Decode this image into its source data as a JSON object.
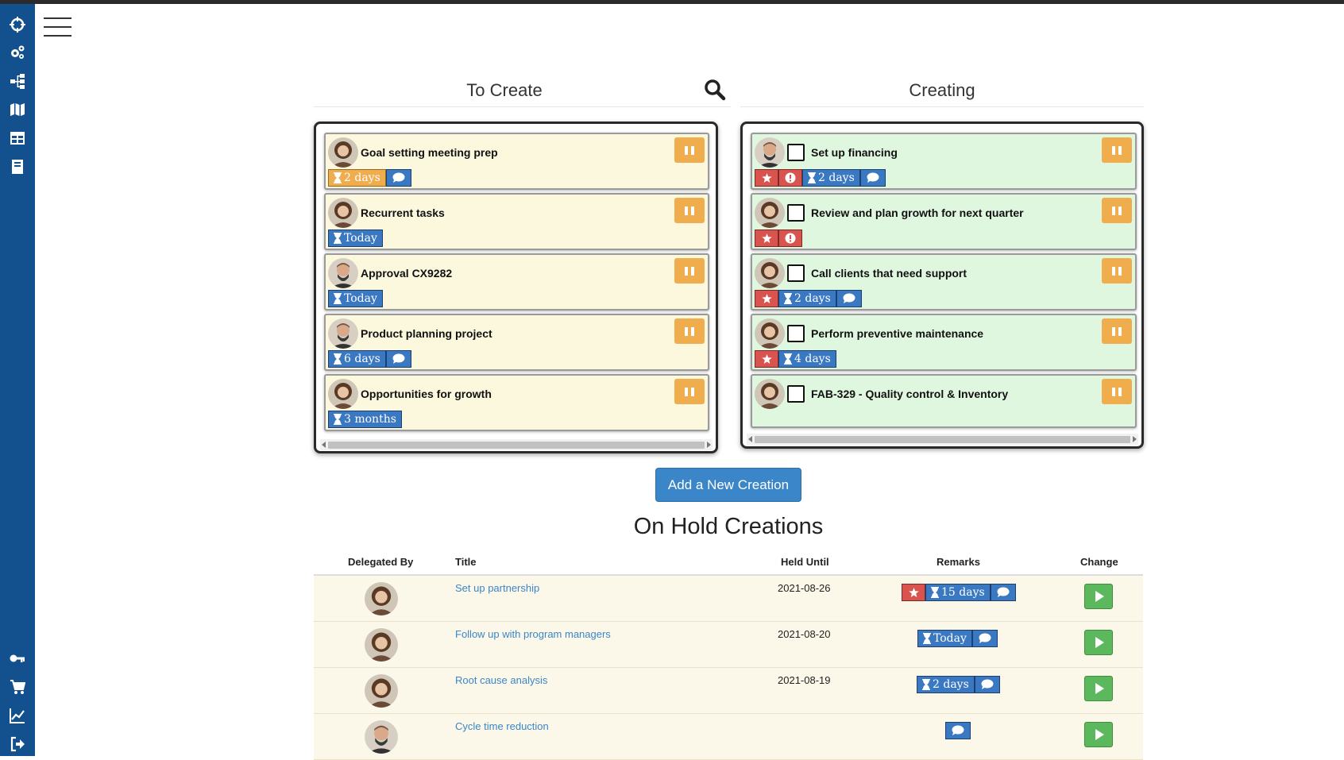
{
  "headers": {
    "to_create": "To Create",
    "creating": "Creating"
  },
  "to_create_cards": [
    {
      "title": "Goal setting meeting prep",
      "time": "2 days",
      "time_style": "orange",
      "chat": true
    },
    {
      "title": "Recurrent tasks",
      "time": "Today",
      "time_style": "blue",
      "chat": false
    },
    {
      "title": "Approval CX9282",
      "time": "Today",
      "time_style": "blue",
      "chat": false
    },
    {
      "title": "Product planning project",
      "time": "6 days",
      "time_style": "blue",
      "chat": true
    },
    {
      "title": "Opportunities for growth",
      "time": "3 months",
      "time_style": "blue",
      "chat": false
    }
  ],
  "creating_cards": [
    {
      "title": "Set up financing",
      "star": true,
      "alert": true,
      "time": "2 days",
      "chat": true
    },
    {
      "title": "Review and plan growth for next quarter",
      "star": true,
      "alert": true,
      "time": "",
      "chat": false
    },
    {
      "title": "Call clients that need support",
      "star": true,
      "alert": false,
      "time": "2 days",
      "chat": true
    },
    {
      "title": "Perform preventive maintenance",
      "star": true,
      "alert": false,
      "time": "4 days",
      "chat": false
    },
    {
      "title": "FAB-329 - Quality control & Inventory",
      "star": false,
      "alert": false,
      "time": "",
      "chat": false
    }
  ],
  "add_button_label": "Add a New Creation",
  "on_hold_title": "On Hold Creations",
  "table_headers": {
    "delegated_by": "Delegated By",
    "title": "Title",
    "held_until": "Held Until",
    "remarks": "Remarks",
    "change": "Change"
  },
  "on_hold_rows": [
    {
      "title": "Set up partnership",
      "held_until": "2021-08-26",
      "star": true,
      "time": "15 days",
      "chat": true
    },
    {
      "title": "Follow up with program managers",
      "held_until": "2021-08-20",
      "star": false,
      "time": "Today",
      "chat": true
    },
    {
      "title": "Root cause analysis",
      "held_until": "2021-08-19",
      "star": false,
      "time": "2 days",
      "chat": true
    },
    {
      "title": "Cycle time reduction",
      "held_until": "",
      "star": false,
      "time": "",
      "chat": true
    }
  ],
  "sidebar_icons": [
    "crosshair-icon",
    "gears-icon",
    "sitemap-icon",
    "map-icon",
    "table-icon",
    "book-icon",
    "key-icon",
    "cart-icon",
    "chart-icon",
    "logout-icon"
  ],
  "colors": {
    "sidebar": "#13508e",
    "badge_blue": "#3a78c2",
    "badge_orange": "#f0ad4e",
    "badge_red": "#d9534f",
    "card_yellow": "#fbf8dd",
    "card_green": "#e0f7df",
    "play_green": "#5cb85c",
    "link": "#3a86c8"
  }
}
